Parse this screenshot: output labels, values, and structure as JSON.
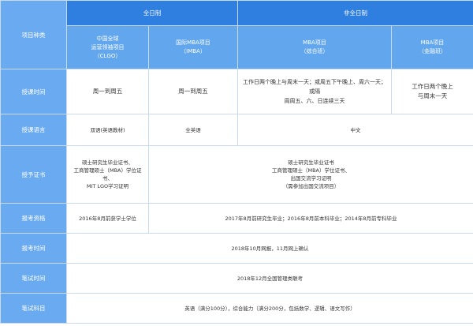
{
  "header": {
    "project_type": "项目种类",
    "full_time": "全日制",
    "part_time": "非全日制",
    "programs": [
      [
        "中国全球",
        "运营领袖项目",
        "（CLGO）"
      ],
      [
        "国际MBA项目",
        "（IMBA）"
      ],
      [
        "MBA项目",
        "（综合班）"
      ],
      [
        "MBA项目",
        "（金融班）"
      ]
    ]
  },
  "rows": {
    "schedule": {
      "label": "授课时间",
      "clgo": "周一到周五",
      "imba": "周一到周五",
      "mba_general": [
        "工作日两个晚上与周末一天；或周五下午晚上、周六一天；或隔",
        "周周五、六、日连续三天"
      ],
      "mba_finance": [
        "工作日两个晚上",
        "与周末一天"
      ]
    },
    "language": {
      "label": "授课语言",
      "clgo": "双语(英语教材)",
      "imba": "全英语",
      "part_time": "中文"
    },
    "certificate": {
      "label": "授予证书",
      "clgo": [
        "硕士研究生毕业证书、",
        "工商管理硕士（MBA）学位证书、",
        "MIT LGO学习证明"
      ],
      "others": [
        "硕士研究生毕业证书",
        "工商管理硕士（MBA）学位证书、",
        "出国交流学习证明",
        "（需参加出国交流项目）"
      ]
    },
    "eligibility": {
      "label": "报考资格",
      "clgo": "2016年8月前获学士学位",
      "others": "2017年8月前研究生毕业；2016年8月前本科毕业；2014年8月前专科毕业"
    },
    "registration": {
      "label": "报考时间",
      "value": "2018年10月网报，11月网上确认"
    },
    "exam_time": {
      "label": "笔试时间",
      "value": "2018年12月全国管理类联考"
    },
    "exam_subjects": {
      "label": "笔试科目",
      "value": "英语（满分100分），综合能力（满分200分，包括数学、逻辑、语文写作）"
    }
  }
}
